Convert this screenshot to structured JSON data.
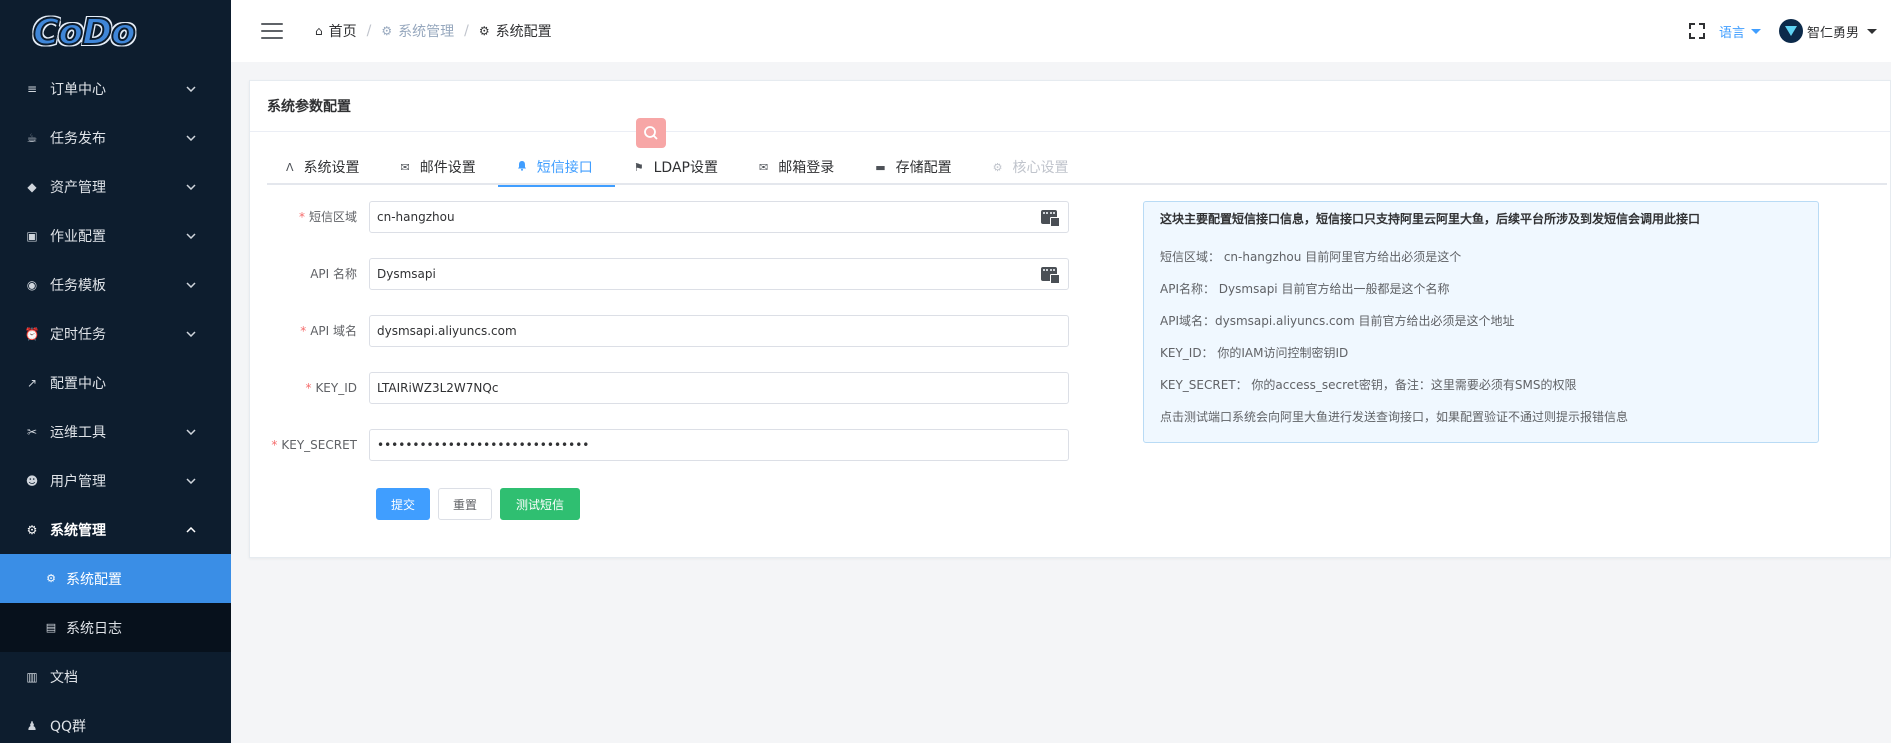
{
  "sidebar": {
    "logo": "CoDo",
    "items": [
      {
        "label": "订单中心",
        "icon": "list-icon",
        "glyph": "≡",
        "arrow": "down"
      },
      {
        "label": "任务发布",
        "icon": "cup-icon",
        "glyph": "☕",
        "arrow": "down"
      },
      {
        "label": "资产管理",
        "icon": "cube-icon",
        "glyph": "◆",
        "arrow": "down"
      },
      {
        "label": "作业配置",
        "icon": "print-icon",
        "glyph": "▣",
        "arrow": "down"
      },
      {
        "label": "任务模板",
        "icon": "eye-slash-icon",
        "glyph": "◉",
        "arrow": "down"
      },
      {
        "label": "定时任务",
        "icon": "alarm-icon",
        "glyph": "⏰",
        "arrow": "down"
      },
      {
        "label": "配置中心",
        "icon": "arrow-up-left-icon",
        "glyph": "↗",
        "arrow": ""
      },
      {
        "label": "运维工具",
        "icon": "tools-icon",
        "glyph": "✂",
        "arrow": "down"
      },
      {
        "label": "用户管理",
        "icon": "users-icon",
        "glyph": "☻",
        "arrow": "down"
      },
      {
        "label": "系统管理",
        "icon": "gear-icon",
        "glyph": "⚙",
        "arrow": "up"
      }
    ],
    "sub_items": [
      {
        "label": "系统配置",
        "icon": "gear-icon",
        "glyph": "⚙",
        "active": true
      },
      {
        "label": "系统日志",
        "icon": "file-icon",
        "glyph": "▤",
        "active": false
      }
    ],
    "bottom_items": [
      {
        "label": "文档",
        "icon": "book-icon",
        "glyph": "▥"
      },
      {
        "label": "QQ群",
        "icon": "bell-icon",
        "glyph": "♟"
      }
    ]
  },
  "header": {
    "breadcrumb": [
      {
        "label": "首页",
        "icon": "home-icon",
        "glyph": "⌂"
      },
      {
        "label": "系统管理",
        "icon": "gear-icon",
        "glyph": "⚙"
      },
      {
        "label": "系统配置",
        "icon": "gear-icon",
        "glyph": "⚙"
      }
    ],
    "language": "语言",
    "username": "智仁勇男"
  },
  "card": {
    "title": "系统参数配置",
    "tabs": [
      {
        "label": "系统设置",
        "icon": "linux-icon",
        "glyph": "Λ",
        "state": "normal"
      },
      {
        "label": "邮件设置",
        "icon": "mail-icon",
        "glyph": "✉",
        "state": "normal"
      },
      {
        "label": "短信接口",
        "icon": "bell-icon",
        "glyph": "🔔",
        "state": "active"
      },
      {
        "label": "LDAP设置",
        "icon": "flag-icon",
        "glyph": "⚑",
        "state": "normal"
      },
      {
        "label": "邮箱登录",
        "icon": "envelope-icon",
        "glyph": "✉",
        "state": "normal"
      },
      {
        "label": "存储配置",
        "icon": "folder-icon",
        "glyph": "▬",
        "state": "normal"
      },
      {
        "label": "核心设置",
        "icon": "gear-icon",
        "glyph": "⚙",
        "state": "disabled"
      }
    ],
    "form": {
      "fields": [
        {
          "label": "短信区域",
          "required": true,
          "value": "cn-hangzhou",
          "has_icon": true
        },
        {
          "label": "API 名称",
          "required": false,
          "value": "Dysmsapi",
          "has_icon": true
        },
        {
          "label": "API 域名",
          "required": true,
          "value": "dysmsapi.aliyuncs.com",
          "has_icon": false
        },
        {
          "label": "KEY_ID",
          "required": true,
          "value": "LTAIRiWZ3L2W7NQc",
          "has_icon": false
        },
        {
          "label": "KEY_SECRET",
          "required": true,
          "value": "••••••••••••••••••••••••••••••",
          "has_icon": false
        }
      ],
      "submit": "提交",
      "reset": "重置",
      "test": "测试短信"
    },
    "info": {
      "title": "这块主要配置短信接口信息，短信接口只支持阿里云阿里大鱼，后续平台所涉及到发短信会调用此接口",
      "lines": [
        "短信区域： cn-hangzhou 目前阿里官方给出必须是这个",
        "API名称： Dysmsapi 目前官方给出一般都是这个名称",
        "API域名：dysmsapi.aliyuncs.com 目前官方给出必须是这个地址",
        "KEY_ID： 你的IAM访问控制密钥ID",
        "KEY_SECRET： 你的access_secret密钥，备注：这里需要必须有SMS的权限",
        "点击测试端口系统会向阿里大鱼进行发送查询接口，如果配置验证不通过则提示报错信息"
      ]
    }
  },
  "colors": {
    "sidebar_bg": "#0d1d2e",
    "active_blue": "#409eff",
    "success_green": "#2fbf71",
    "required_red": "#f56c6c"
  }
}
